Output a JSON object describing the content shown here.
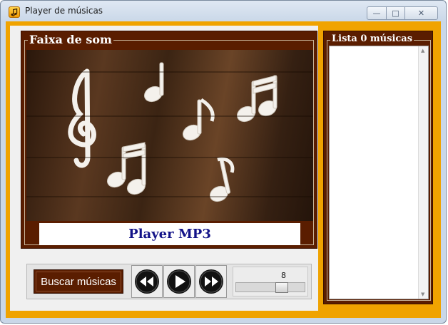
{
  "window": {
    "title": "Player de músicas",
    "controls": {
      "minimize": "—",
      "maximize": "□",
      "close": "✕"
    }
  },
  "panel_faixa": {
    "legend": "Faixa de som",
    "image": "music-notes-on-wood-photo",
    "label": "Player MP3"
  },
  "controls": {
    "buscar_label": "Buscar músicas",
    "buttons": [
      "rewind-icon",
      "play-icon",
      "fast-forward-icon"
    ],
    "volume": {
      "value": "8",
      "level": 0.7
    }
  },
  "panel_lista": {
    "legend": "Lista 0 músicas",
    "items": []
  },
  "colors": {
    "brown": "#5a1d00",
    "orange": "#f0a300",
    "label_text": "#121288"
  }
}
